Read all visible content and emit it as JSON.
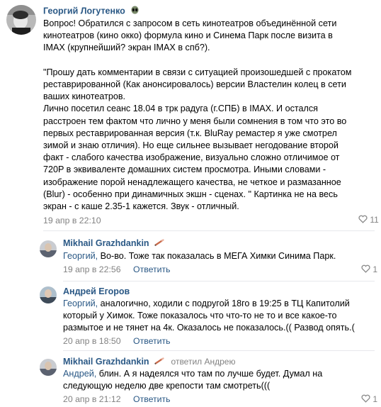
{
  "comments": [
    {
      "author": "Георгий Логутенко",
      "lines": [
        "Вопрос! Обратился с запросом в сеть кинотеатров объединённой сети",
        "кинотеатров (кино окко) формула кино и Синема Парк после визита в",
        "IMAX (крупнейший? экран IMAX в спб?).",
        "",
        "\"Прошу дать комментарии в связи с ситуацией произошедшей с прокатом",
        "реставрированной (Как анонсировалось) версии Властелин колец в сети",
        "ваших кинотеатров.",
        "Лично посетил сеанс 18.04 в трк радуга (г.СПБ) в IMAX. И остался",
        "расстроен тем фактом что лично у меня были сомнения в том что это во",
        "первых реставрированная версия (т.к. BluRay ремастер я уже смотрел",
        "зимой и знаю отличия). Но еще сильнее вызывает негодование второй",
        "факт - слабого качества изображение, визуально сложно отличимое от",
        "720P в эквиваленте домашних систем просмотра. Иными словами -",
        "изображение порой ненадлежащего качества, не четкое и размазанное",
        "(Blur) - особенно при динамичных экшн - сценах. \" Картинка не на весь",
        "экран - с каше 2.35-1 кажется. Звук - отличный."
      ],
      "date": "19 апр в 22:10",
      "likes": "11"
    },
    {
      "author": "Mikhail Grazhdankin",
      "mention": "Георгий,",
      "lines": [
        " Во-во. Тоже так показалась в МЕГА Химки Синима Парк."
      ],
      "date": "19 апр в 22:56",
      "reply": "Ответить",
      "likes": "1"
    },
    {
      "author": "Андрей Егоров",
      "mention": "Георгий,",
      "lines": [
        " аналогично, ходили с подругой 18го в 19:25 в ТЦ Капитолий",
        "который у Химок. Тоже показалось что что-то не то и все какое-то",
        "размытое и не тянет на 4к. Оказалось не показалось.(( Развод опять.("
      ],
      "date": "20 апр в 18:50",
      "reply": "Ответить"
    },
    {
      "author": "Mikhail Grazhdankin",
      "reply_to": "ответил Андрею",
      "mention": "Андрей,",
      "lines": [
        " блин. А я надеялся что там по лучше будет. Думал на",
        "следующую неделю две крепости там смотреть((("
      ],
      "date": "20 апр в 21:12",
      "reply": "Ответить",
      "likes": "1"
    }
  ]
}
